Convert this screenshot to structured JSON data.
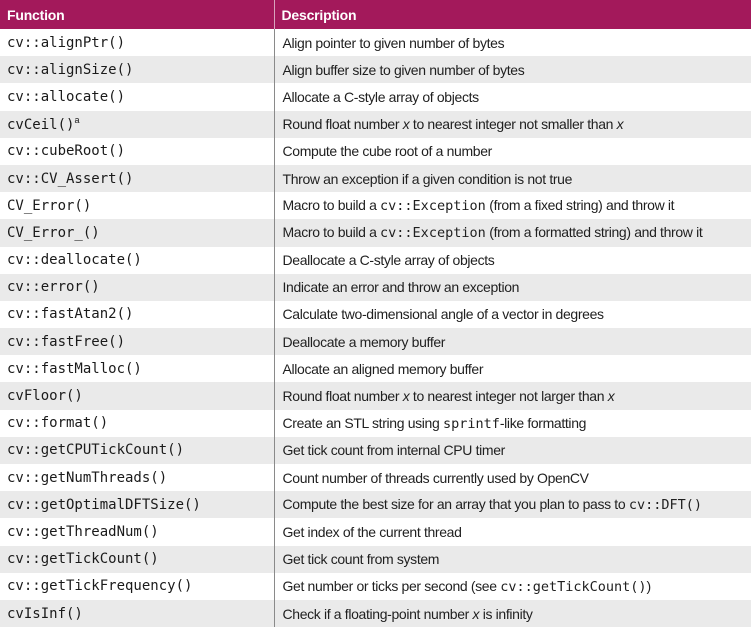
{
  "headers": {
    "function": "Function",
    "description": "Description"
  },
  "rows": [
    {
      "function": "cv::alignPtr()",
      "description": [
        "Align pointer to given number of bytes"
      ]
    },
    {
      "function": "cv::alignSize()",
      "description": [
        "Align buffer size to given number of bytes"
      ]
    },
    {
      "function": "cv::allocate()",
      "description": [
        "Allocate a C-style array of objects"
      ]
    },
    {
      "function": "cvCeil()",
      "footnote": "a",
      "description": [
        "Round float number ",
        {
          "i": "x"
        },
        " to nearest integer not smaller than ",
        {
          "i": "x"
        }
      ]
    },
    {
      "function": "cv::cubeRoot()",
      "description": [
        "Compute the cube root of a number"
      ]
    },
    {
      "function": "cv::CV_Assert()",
      "description": [
        "Throw an exception if a given condition is not true"
      ]
    },
    {
      "function": "CV_Error()",
      "description": [
        "Macro to build a ",
        {
          "c": "cv::Exception"
        },
        " (from a fixed string) and throw it"
      ]
    },
    {
      "function": "CV_Error_()",
      "description": [
        "Macro to build a ",
        {
          "c": "cv::Exception"
        },
        " (from a formatted string) and throw it"
      ]
    },
    {
      "function": "cv::deallocate()",
      "description": [
        "Deallocate a C-style array of objects"
      ]
    },
    {
      "function": "cv::error()",
      "description": [
        "Indicate an error and throw an exception"
      ]
    },
    {
      "function": "cv::fastAtan2()",
      "description": [
        "Calculate two-dimensional angle of a vector in degrees"
      ]
    },
    {
      "function": "cv::fastFree()",
      "description": [
        "Deallocate a memory buffer"
      ]
    },
    {
      "function": "cv::fastMalloc()",
      "description": [
        "Allocate an aligned memory buffer"
      ]
    },
    {
      "function": "cvFloor()",
      "description": [
        "Round float number ",
        {
          "i": "x"
        },
        " to nearest integer not larger than ",
        {
          "i": "x"
        }
      ]
    },
    {
      "function": "cv::format()",
      "description": [
        "Create an STL string using ",
        {
          "c": "sprintf"
        },
        "-like formatting"
      ]
    },
    {
      "function": "cv::getCPUTickCount()",
      "description": [
        "Get tick count from internal CPU timer"
      ]
    },
    {
      "function": "cv::getNumThreads()",
      "description": [
        "Count number of threads currently used by OpenCV"
      ]
    },
    {
      "function": "cv::getOptimalDFTSize()",
      "description": [
        "Compute the best size for an array that you plan to pass to ",
        {
          "c": "cv::DFT()"
        }
      ]
    },
    {
      "function": "cv::getThreadNum()",
      "description": [
        "Get index of the current thread"
      ]
    },
    {
      "function": "cv::getTickCount()",
      "description": [
        "Get tick count from system"
      ]
    },
    {
      "function": "cv::getTickFrequency()",
      "description": [
        "Get number or ticks per second (see ",
        {
          "c": "cv::getTickCount()"
        },
        ")"
      ]
    },
    {
      "function": "cvIsInf()",
      "description": [
        "Check if a floating-point number ",
        {
          "i": "x"
        },
        " is infinity"
      ]
    }
  ]
}
